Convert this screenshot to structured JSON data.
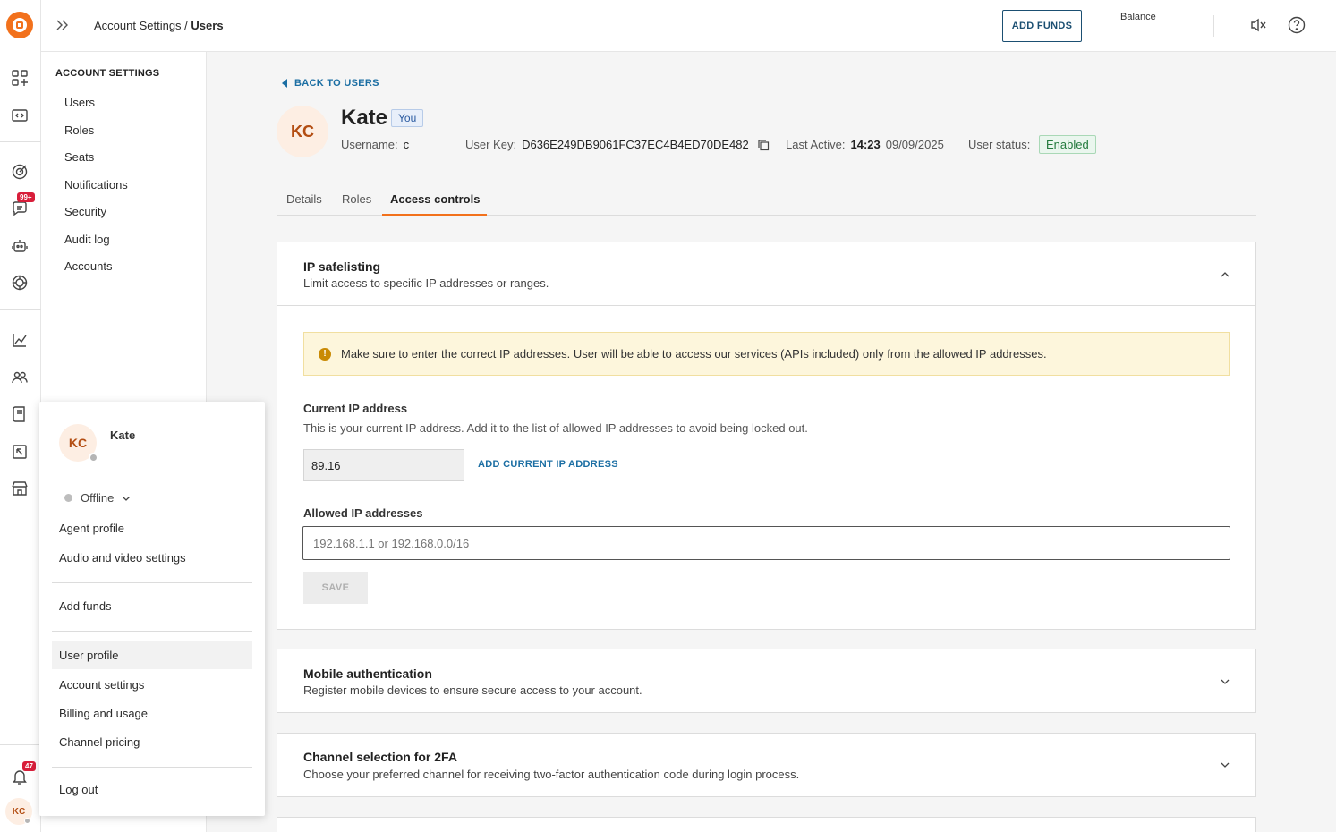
{
  "topbar": {
    "breadcrumb_parent": "Account Settings /",
    "breadcrumb_current": "Users",
    "add_funds": "ADD FUNDS",
    "balance_label": "Balance"
  },
  "rail": {
    "chat_badge": "99+",
    "notif_badge": "47",
    "avatar_initials": "KC"
  },
  "sidebar": {
    "heading": "ACCOUNT SETTINGS",
    "items": [
      "Users",
      "Roles",
      "Seats",
      "Notifications",
      "Security",
      "Audit log",
      "Accounts"
    ]
  },
  "user": {
    "back": "BACK TO USERS",
    "initials": "KC",
    "name": "Kate",
    "you_badge": "You",
    "username_label": "Username:",
    "username": "c",
    "key_label": "User Key:",
    "key": "D636E249DB9061FC37EC4B4ED70DE482",
    "last_active_label": "Last Active:",
    "last_active_time": "14:23",
    "last_active_date": "09/09/2025",
    "status_label": "User status:",
    "status": "Enabled"
  },
  "tabs": [
    "Details",
    "Roles",
    "Access controls"
  ],
  "ip_section": {
    "title": "IP safelisting",
    "subtitle": "Limit access to specific IP addresses or ranges.",
    "warning": "Make sure to enter the correct IP addresses. User will be able to access our services (APIs included) only from the allowed IP addresses.",
    "current_label": "Current IP address",
    "current_desc": "This is your current IP address. Add it to the list of allowed IP addresses to avoid being locked out.",
    "current_ip": "89.16",
    "add_current": "ADD CURRENT IP ADDRESS",
    "allowed_label": "Allowed IP addresses",
    "allowed_placeholder": "192.168.1.1 or 192.168.0.0/16",
    "save": "SAVE"
  },
  "mobile_section": {
    "title": "Mobile authentication",
    "subtitle": "Register mobile devices to ensure secure access to your account."
  },
  "twofa_section": {
    "title": "Channel selection for 2FA",
    "subtitle": "Choose your preferred channel for receiving two-factor authentication code during login process."
  },
  "popup": {
    "initials": "KC",
    "name": "Kate",
    "status": "Offline",
    "agent_profile": "Agent profile",
    "audio_video": "Audio and video settings",
    "add_funds": "Add funds",
    "user_profile": "User profile",
    "account_settings": "Account settings",
    "billing": "Billing and usage",
    "channel_pricing": "Channel pricing",
    "logout": "Log out"
  },
  "colors": {
    "brand": "#f2711c",
    "link": "#1b6ea3",
    "enabled_green": "#237a3d",
    "warning_bg": "#fdf6dc"
  }
}
